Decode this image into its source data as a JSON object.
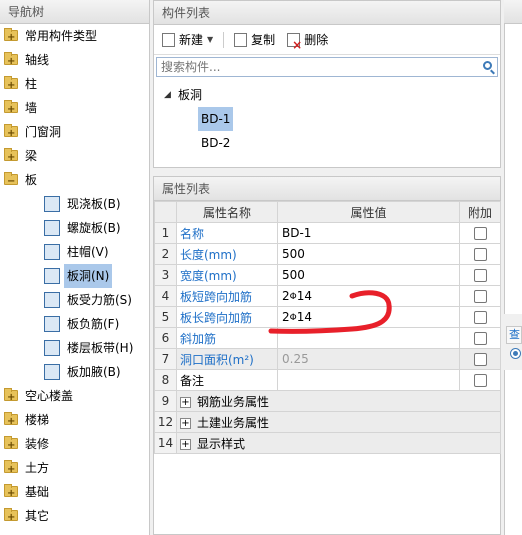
{
  "nav": {
    "title": "导航树",
    "items": [
      {
        "label": "常用构件类型"
      },
      {
        "label": "轴线"
      },
      {
        "label": "柱"
      },
      {
        "label": "墙"
      },
      {
        "label": "门窗洞"
      },
      {
        "label": "梁"
      },
      {
        "label": "板"
      }
    ],
    "board_children": [
      {
        "label": "现浇板(B)"
      },
      {
        "label": "螺旋板(B)"
      },
      {
        "label": "柱帽(V)"
      },
      {
        "label": "板洞(N)"
      },
      {
        "label": "板受力筋(S)"
      },
      {
        "label": "板负筋(F)"
      },
      {
        "label": "楼层板带(H)"
      },
      {
        "label": "板加腋(B)"
      }
    ],
    "items_after": [
      {
        "label": "空心楼盖"
      },
      {
        "label": "楼梯"
      },
      {
        "label": "装修"
      },
      {
        "label": "土方"
      },
      {
        "label": "基础"
      },
      {
        "label": "其它"
      }
    ],
    "selected": "板洞(N)"
  },
  "component_list": {
    "title": "构件列表",
    "toolbar": {
      "new": "新建",
      "copy": "复制",
      "delete": "删除"
    },
    "search_placeholder": "搜索构件...",
    "root": "板洞",
    "children": [
      "BD-1",
      "BD-2"
    ],
    "selected": "BD-1"
  },
  "property_list": {
    "title": "属性列表",
    "headers": {
      "num": "",
      "name": "属性名称",
      "value": "属性值",
      "add": "附加"
    },
    "rows": [
      {
        "num": "1",
        "name": "名称",
        "value": "BD-1"
      },
      {
        "num": "2",
        "name": "长度(mm)",
        "value": "500"
      },
      {
        "num": "3",
        "name": "宽度(mm)",
        "value": "500"
      },
      {
        "num": "4",
        "name": "板短跨向加筋",
        "value": "2",
        "value_suffix": "14"
      },
      {
        "num": "5",
        "name": "板长跨向加筋",
        "value": "2",
        "value_suffix": "14"
      },
      {
        "num": "6",
        "name": "斜加筋",
        "value": ""
      },
      {
        "num": "7",
        "name": "洞口面积(m²)",
        "value": "0.25"
      },
      {
        "num": "8",
        "name": "备注",
        "value": ""
      },
      {
        "num": "9",
        "name": "钢筋业务属性",
        "value": ""
      },
      {
        "num": "12",
        "name": "土建业务属性",
        "value": ""
      },
      {
        "num": "14",
        "name": "显示样式",
        "value": ""
      }
    ],
    "rebar_symbol": "Φ"
  },
  "right_panel": {
    "tab_char": "查"
  },
  "colors": {
    "link_blue": "#1e6fc7",
    "selection": "#aac8ea",
    "annotation_red": "#e8202a"
  }
}
